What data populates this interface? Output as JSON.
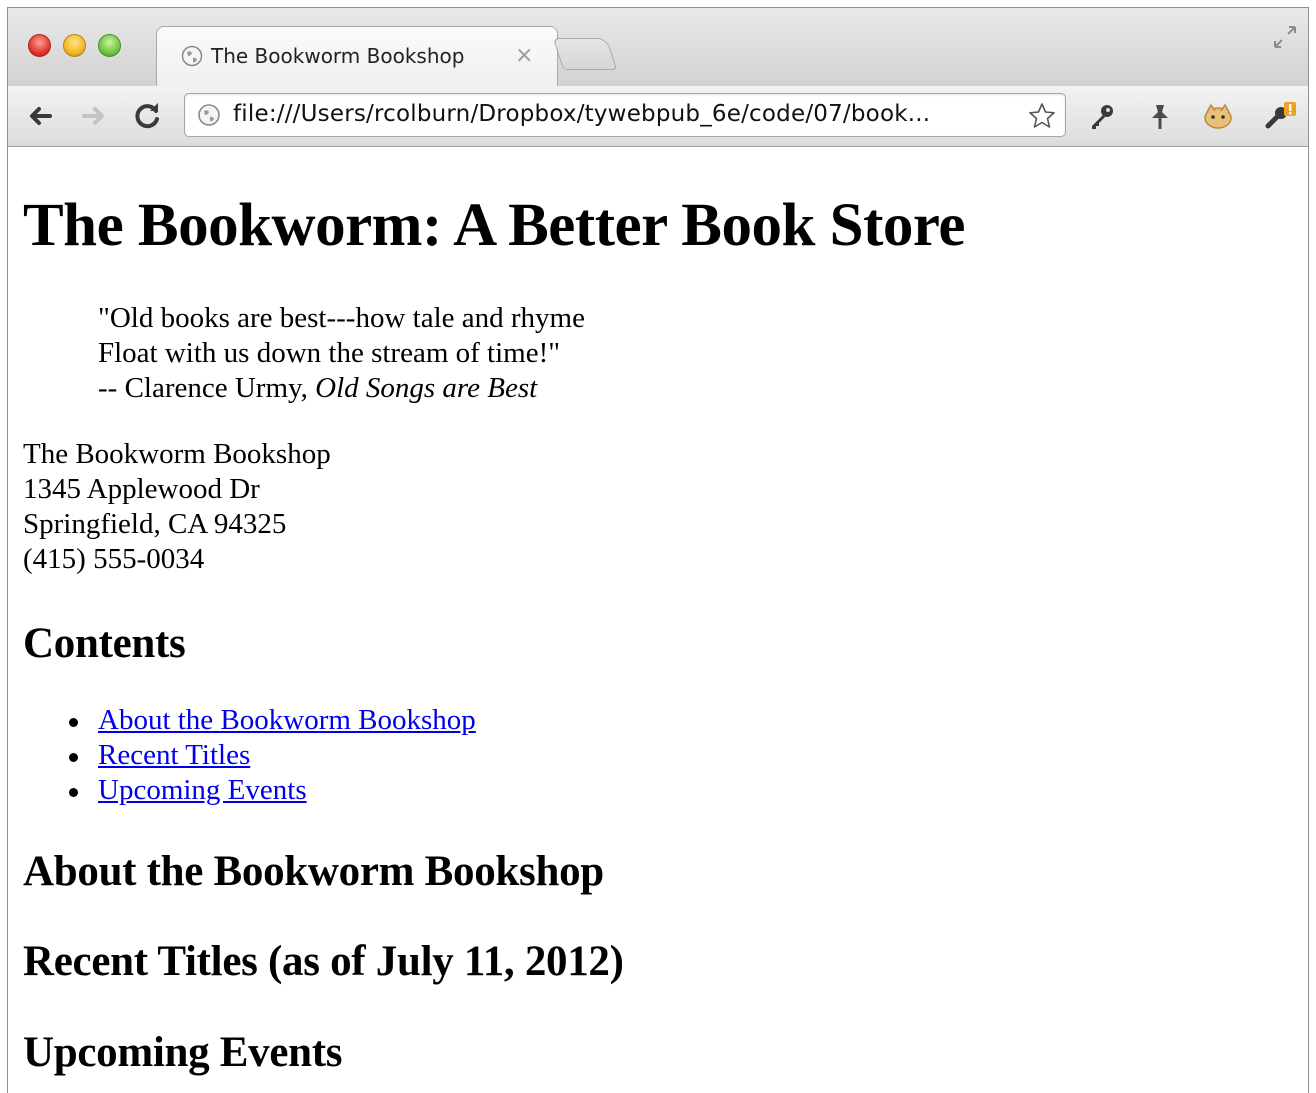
{
  "browser": {
    "tab_title": "The Bookworm Bookshop",
    "tab_close": "×",
    "address": "file:///Users/rcolburn/Dropbox/tywebpub_6e/code/07/book..."
  },
  "page": {
    "heading": "The Bookworm: A Better Book Store",
    "quote": {
      "line1": "\"Old books are best---how tale and rhyme",
      "line2": "Float with us down the stream of time!\"",
      "attribution_prefix": "-- Clarence Urmy, ",
      "attribution_title": "Old Songs are Best"
    },
    "address": {
      "name": "The Bookworm Bookshop",
      "street": "1345 Applewood Dr",
      "city": "Springfield, CA 94325",
      "phone": "(415) 555-0034"
    },
    "contents_heading": "Contents",
    "contents_links": [
      "About the Bookworm Bookshop",
      "Recent Titles",
      "Upcoming Events"
    ],
    "section_about": "About the Bookworm Bookshop",
    "section_recent": "Recent Titles (as of July 11, 2012)",
    "section_events": "Upcoming Events"
  }
}
